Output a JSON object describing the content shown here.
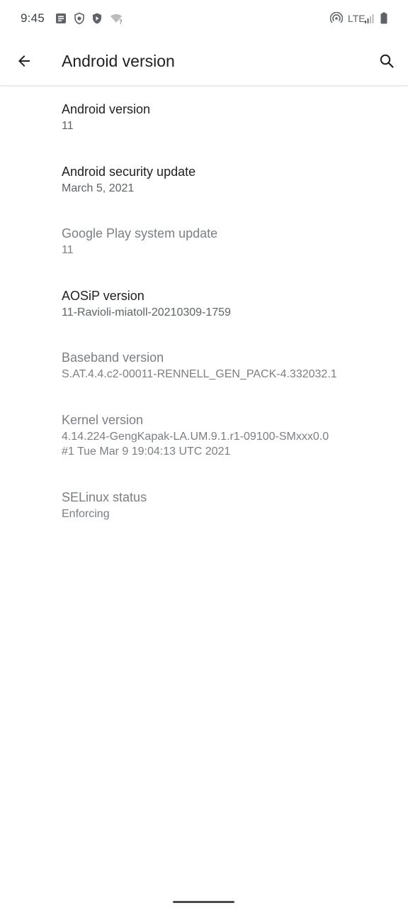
{
  "status_bar": {
    "time": "9:45",
    "network": "LTE",
    "icons": [
      "notes-icon",
      "shield-bug-icon",
      "shield-play-icon",
      "wifi-question-icon",
      "hotspot-icon",
      "signal-icon",
      "battery-icon"
    ]
  },
  "app_bar": {
    "title": "Android version",
    "back_icon": "arrow-back-icon",
    "search_icon": "search-icon"
  },
  "items": [
    {
      "title": "Android version",
      "summary": [
        "11"
      ],
      "enabled": true
    },
    {
      "title": "Android security update",
      "summary": [
        "March 5, 2021"
      ],
      "enabled": true
    },
    {
      "title": "Google Play system update",
      "summary": [
        "11"
      ],
      "enabled": false
    },
    {
      "title": "AOSiP version",
      "summary": [
        "11-Ravioli-miatoll-20210309-1759"
      ],
      "enabled": true
    },
    {
      "title": "Baseband version",
      "summary": [
        "S.AT.4.4.c2-00011-RENNELL_GEN_PACK-4.332032.1"
      ],
      "enabled": false
    },
    {
      "title": "Kernel version",
      "summary": [
        "4.14.224-GengKapak-LA.UM.9.1.r1-09100-SMxxx0.0",
        "#1 Tue Mar 9 19:04:13 UTC 2021"
      ],
      "enabled": false
    },
    {
      "title": "SELinux status",
      "summary": [
        "Enforcing"
      ],
      "enabled": false
    }
  ],
  "colors": {
    "text_primary": "#202124",
    "text_secondary": "#5f6368",
    "text_disabled": "#7b7f83",
    "background": "#ffffff"
  }
}
